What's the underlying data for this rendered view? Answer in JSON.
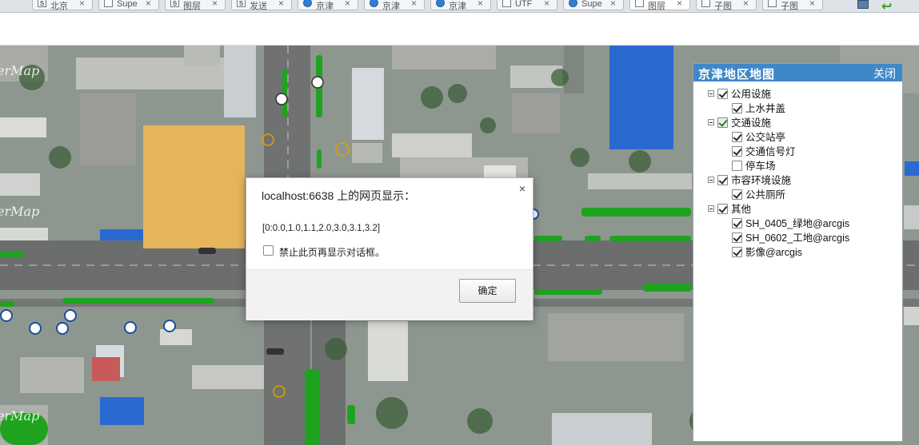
{
  "tabs": [
    {
      "label": "北京",
      "icon": "s-logo-icon"
    },
    {
      "label": "Supe",
      "icon": "doc-icon"
    },
    {
      "label": "图层",
      "icon": "s-logo-icon"
    },
    {
      "label": "发送",
      "icon": "s-logo-icon"
    },
    {
      "label": "京津",
      "icon": "supermap-icon"
    },
    {
      "label": "京津",
      "icon": "supermap-icon"
    },
    {
      "label": "京津",
      "icon": "supermap-icon"
    },
    {
      "label": "UTF",
      "icon": "doc-icon"
    },
    {
      "label": "Supe",
      "icon": "globe-icon"
    },
    {
      "label": "图层",
      "icon": "doc-icon"
    },
    {
      "label": "子图",
      "icon": "doc-icon"
    },
    {
      "label": "子图",
      "icon": "doc-icon"
    }
  ],
  "tab_close_glyph": "×",
  "map": {
    "watermark": "erMap"
  },
  "layer_panel": {
    "title": "京津地区地图",
    "close_label": "关闭",
    "groups": [
      {
        "label": "公用设施",
        "checked": true,
        "items": [
          {
            "label": "上水井盖",
            "checked": true
          }
        ]
      },
      {
        "label": "交通设施",
        "checked": "partial",
        "items": [
          {
            "label": "公交站亭",
            "checked": true
          },
          {
            "label": "交通信号灯",
            "checked": true
          },
          {
            "label": "停车场",
            "checked": false
          }
        ]
      },
      {
        "label": "市容环境设施",
        "checked": true,
        "items": [
          {
            "label": "公共厕所",
            "checked": true
          }
        ]
      },
      {
        "label": "其他",
        "checked": true,
        "items": [
          {
            "label": "SH_0405_绿地@arcgis",
            "checked": true
          },
          {
            "label": "SH_0602_工地@arcgis",
            "checked": true
          },
          {
            "label": "影像@arcgis",
            "checked": true
          }
        ]
      }
    ]
  },
  "dialog": {
    "title": "localhost:6638 上的网页显示：",
    "close_glyph": "×",
    "message": "[0:0.0,1.0,1.1,2.0,3.0,3.1,3.2]",
    "suppress_label": "禁止此页再显示对话框。",
    "suppress_checked": false,
    "ok_label": "确定"
  },
  "colors": {
    "panel_header": "#3f88c8",
    "greenbelt": "#1fa31f",
    "construction_site": "#e6b45a"
  }
}
